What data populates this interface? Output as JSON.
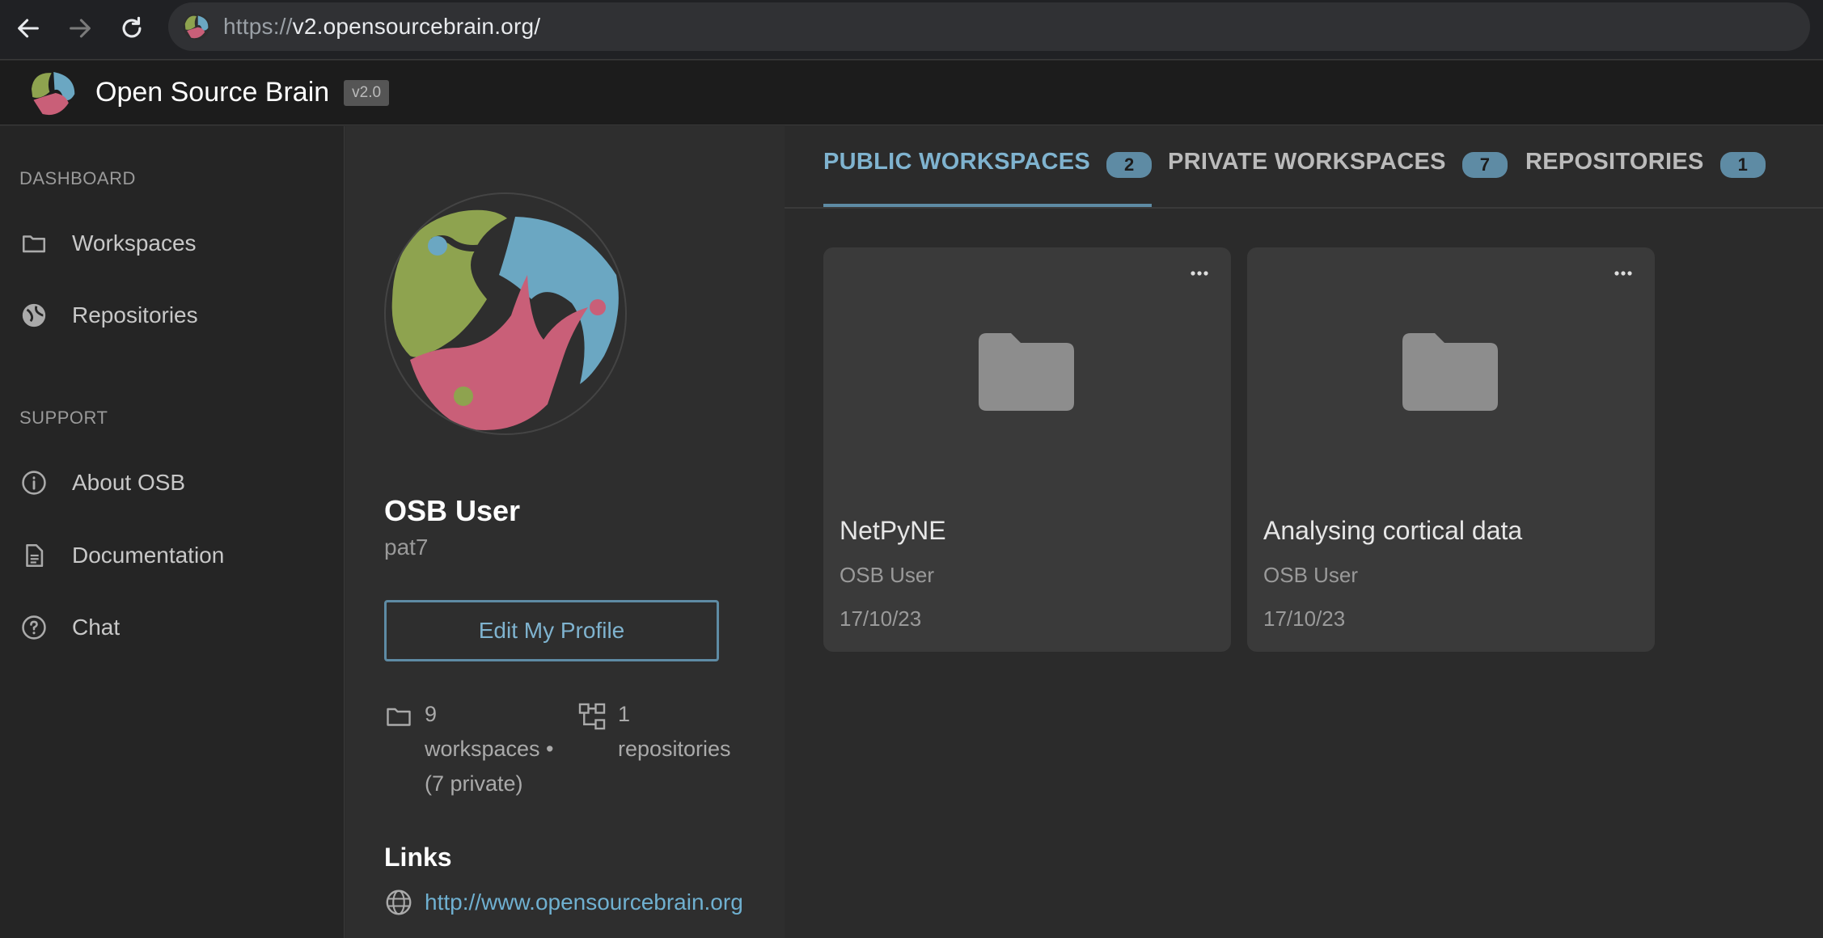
{
  "browser": {
    "url_scheme": "https://",
    "url_host": "v2.opensourcebrain.org/"
  },
  "header": {
    "title": "Open Source Brain",
    "version": "v2.0"
  },
  "sidebar": {
    "dashboard_heading": "DASHBOARD",
    "support_heading": "SUPPORT",
    "items": [
      {
        "label": "Workspaces",
        "icon": "folder-icon"
      },
      {
        "label": "Repositories",
        "icon": "globe-icon"
      },
      {
        "label": "About OSB",
        "icon": "info-icon"
      },
      {
        "label": "Documentation",
        "icon": "document-icon"
      },
      {
        "label": "Chat",
        "icon": "help-icon"
      }
    ]
  },
  "profile": {
    "name": "OSB User",
    "username": "pat7",
    "edit_label": "Edit My Profile",
    "workspaces_stat": {
      "count": "9",
      "line1": "workspaces •",
      "line2": "(7 private)"
    },
    "repositories_stat": {
      "count": "1",
      "line1": "repositories"
    },
    "links_title": "Links",
    "link_url": "http://www.opensourcebrain.org"
  },
  "tabs": [
    {
      "label": "PUBLIC WORKSPACES",
      "count": "2",
      "active": true
    },
    {
      "label": "PRIVATE WORKSPACES",
      "count": "7",
      "active": false
    },
    {
      "label": "REPOSITORIES",
      "count": "1",
      "active": false
    }
  ],
  "cards": [
    {
      "title": "NetPyNE",
      "owner": "OSB User",
      "date": "17/10/23"
    },
    {
      "title": "Analysing cortical data",
      "owner": "OSB User",
      "date": "17/10/23"
    }
  ],
  "colors": {
    "accent": "#7fb3cf",
    "badge": "#5e8ba4",
    "logo_green": "#8ea34f",
    "logo_blue": "#6ba7c2",
    "logo_pink": "#c95f78"
  }
}
